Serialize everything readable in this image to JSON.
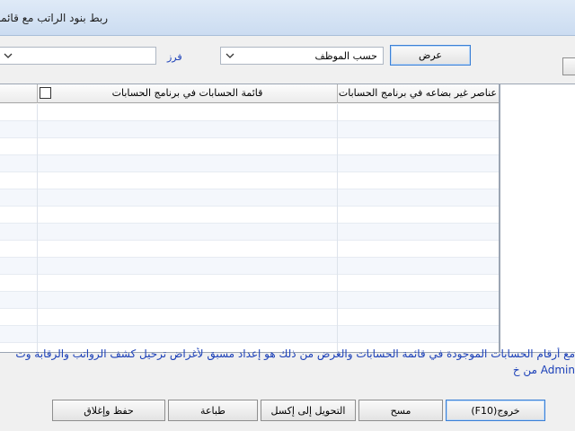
{
  "window": {
    "title": "ربط بنود الراتب مع قائمة"
  },
  "filter": {
    "left_combo_value": "",
    "sort_label": "فرز",
    "sort_combo_value": "حسب الموظف",
    "show_button_label": "عرض"
  },
  "table": {
    "columns": [
      {
        "label": ""
      },
      {
        "label": "قائمة الحسابات في برنامج الحسابات"
      },
      {
        "label": "عناصر غير بضاعه في برنامج الحسابات"
      }
    ],
    "select_all_checked": false,
    "row_count": 14
  },
  "info": {
    "line1": "مع أرقام الحسابات الموجودة في قائمة الحسابات والغرض من ذلك هو إعداد مسبق لأغراض ترحيل كشف الرواتب والرقابة وت",
    "line2": "Admin من خ"
  },
  "buttons": {
    "exit": "(F10)خروج",
    "clear": "مسح",
    "excel": "التحويل إلى إكسل",
    "print": "طباعة",
    "save_close": "حفظ وإغلاق"
  }
}
